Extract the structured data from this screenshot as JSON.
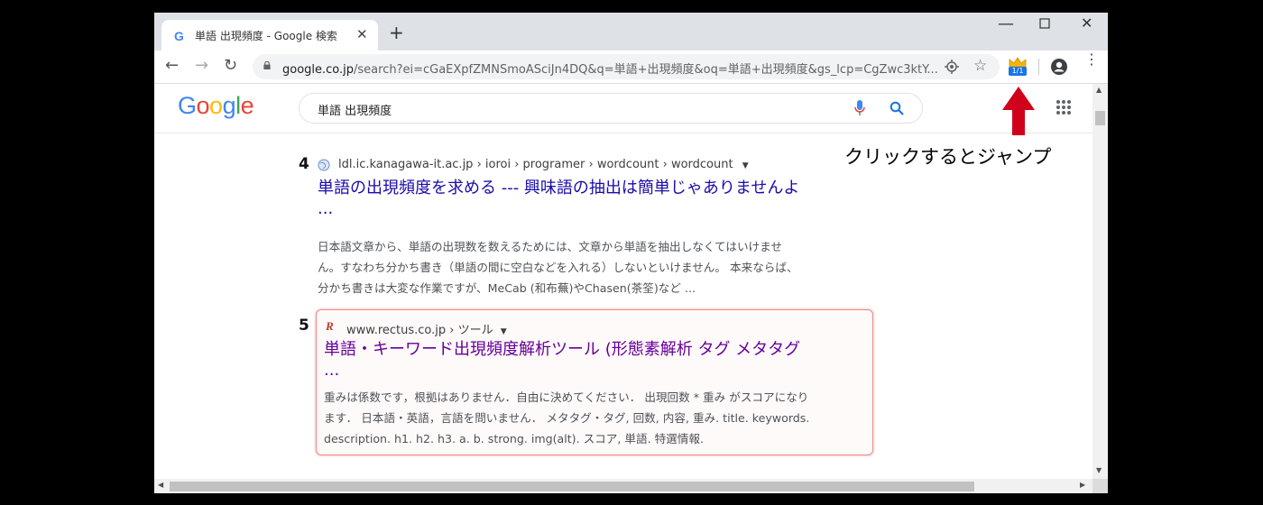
{
  "browser": {
    "tab_title": "単語 出現頻度 - Google 検索",
    "tab_close": "✕",
    "new_tab": "+",
    "url_host": "google.co.jp",
    "url_path": "/search?ei=cGaEXpfZMNSmoASciJn4DQ&q=単語+出現頻度&oq=単語+出現頻度&gs_lcp=CgZwc3ktY...",
    "extension_badge": "1/1"
  },
  "google": {
    "logo": "Google",
    "search_query": "単語 出現頻度"
  },
  "annotation": "クリックするとジャンプ",
  "results": [
    {
      "number": "4",
      "cite": "ldl.ic.kanagawa-it.ac.jp › ioroi › programer › wordcount › wordcount",
      "title_line1": "単語の出現頻度を求める --- 興味語の抽出は簡単じゃありませんよ",
      "title_line2": "...",
      "snippet_lines": [
        "日本語文章から、単語の出現数を数えるためには、文章から単語を抽出しなくてはいけませ",
        "ん。すなわち分かち書き（単語の間に空白などを入れる）しないといけません。 本来ならば、",
        "分かち書きは大変な作業ですが、MeCab (和布蕪)やChasen(茶筌)など ..."
      ]
    },
    {
      "number": "5",
      "favicon": "R",
      "cite": "www.rectus.co.jp › ツール",
      "title_line1": "単語・キーワード出現頻度解析ツール (形態素解析 タグ メタタグ",
      "title_line2": "...",
      "snippet_lines": [
        "重みは係数です，根拠はありません．自由に決めてください． 出現回数 * 重み がスコアになり",
        "ます． 日本語・英語，言語を問いません． メタタグ・タグ, 回数, 内容, 重み. title. keywords.",
        "description. h1. h2. h3. a. b. strong. img(alt). スコア, 単語. 特選情報."
      ]
    }
  ],
  "colors": {
    "link": "#1a0dab",
    "visited": "#660099",
    "arrow": "#d0021b",
    "card_border": "#ee8888"
  }
}
